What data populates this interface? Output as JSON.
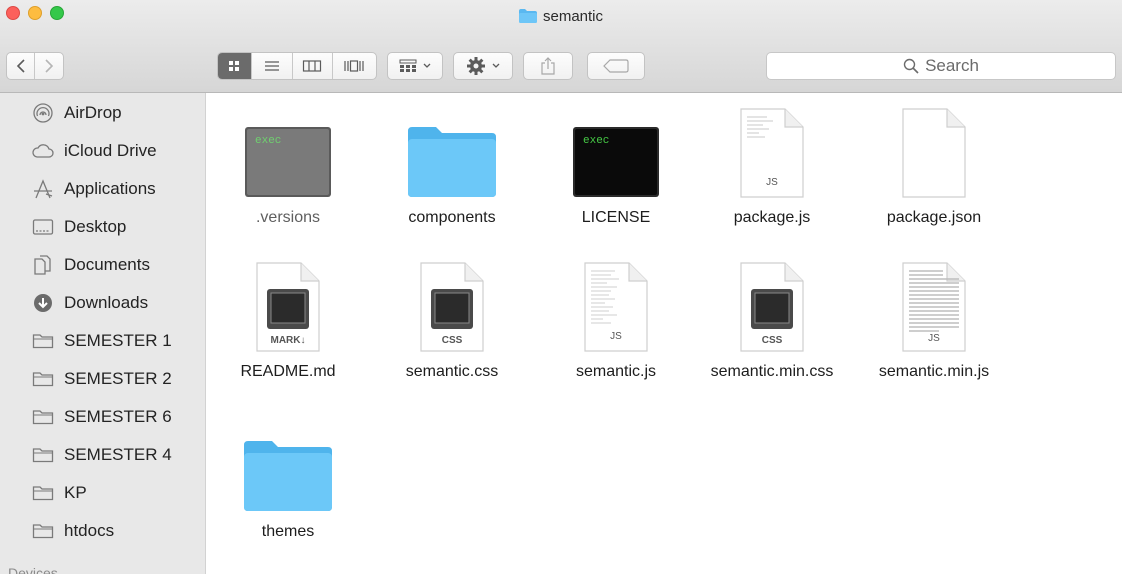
{
  "window": {
    "title": "semantic"
  },
  "toolbar": {
    "back_icon": "chevron-left-icon",
    "forward_icon": "chevron-right-icon",
    "view_modes": [
      "icon-view-icon",
      "list-view-icon",
      "column-view-icon",
      "cover-flow-icon"
    ],
    "active_view": "icon-view-icon",
    "arrange_icon": "arrange-grid-icon",
    "action_icon": "gear-icon",
    "share_icon": "share-icon",
    "tag_icon": "tag-icon",
    "search_placeholder": "Search"
  },
  "sidebar": {
    "items": [
      {
        "label": "AirDrop",
        "icon": "airdrop-icon"
      },
      {
        "label": "iCloud Drive",
        "icon": "cloud-icon"
      },
      {
        "label": "Applications",
        "icon": "applications-icon"
      },
      {
        "label": "Desktop",
        "icon": "desktop-icon"
      },
      {
        "label": "Documents",
        "icon": "documents-icon"
      },
      {
        "label": "Downloads",
        "icon": "downloads-icon"
      },
      {
        "label": "SEMESTER 1",
        "icon": "folder-icon"
      },
      {
        "label": "SEMESTER 2",
        "icon": "folder-icon"
      },
      {
        "label": "SEMESTER 6",
        "icon": "folder-icon"
      },
      {
        "label": "SEMESTER 4",
        "icon": "folder-icon"
      },
      {
        "label": "KP",
        "icon": "folder-icon"
      },
      {
        "label": "htdocs",
        "icon": "folder-icon"
      }
    ],
    "section_devices": "Devices"
  },
  "files": [
    {
      "name": ".versions",
      "kind": "exec",
      "badge": "exec",
      "dim": true
    },
    {
      "name": "components",
      "kind": "folder"
    },
    {
      "name": "LICENSE",
      "kind": "exec",
      "badge": "exec"
    },
    {
      "name": "package.js",
      "kind": "doc",
      "badge": "JS"
    },
    {
      "name": "package.json",
      "kind": "blank"
    },
    {
      "name": "README.md",
      "kind": "app-doc",
      "badge": "MARK↓"
    },
    {
      "name": "semantic.css",
      "kind": "app-doc",
      "badge": "CSS"
    },
    {
      "name": "semantic.js",
      "kind": "doc",
      "badge": "JS"
    },
    {
      "name": "semantic.min.css",
      "kind": "app-doc",
      "badge": "CSS"
    },
    {
      "name": "semantic.min.js",
      "kind": "dense-doc",
      "badge": "JS"
    },
    {
      "name": "themes",
      "kind": "folder"
    }
  ]
}
